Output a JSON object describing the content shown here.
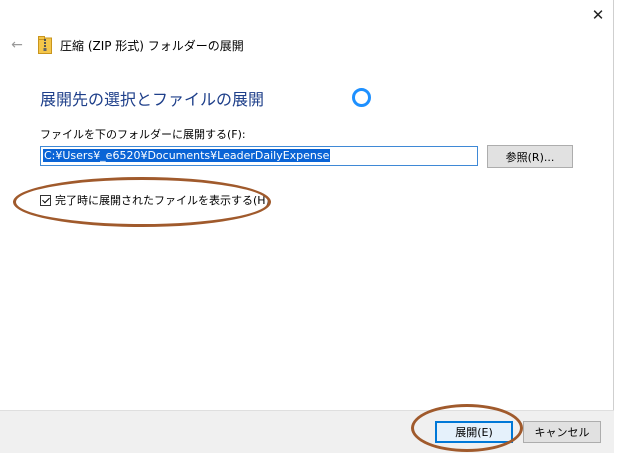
{
  "window": {
    "title": "圧縮 (ZIP 形式) フォルダーの展開",
    "close_symbol": "✕",
    "back_symbol": "←"
  },
  "main": {
    "heading": "展開先の選択とファイルの展開",
    "dest_label": "ファイルを下のフォルダーに展開する(F):",
    "dest_path": "C:¥Users¥_e6520¥Documents¥LeaderDailyExpense",
    "browse_label": "参照(R)...",
    "show_files_label": "完了時に展開されたファイルを表示する(H)",
    "show_files_checked": true
  },
  "footer": {
    "extract_label": "展開(E)",
    "cancel_label": "キャンセル"
  },
  "icons": {
    "back": "back-arrow-icon",
    "zip": "zip-folder-icon",
    "close": "close-icon",
    "spinner": "loading-spinner-icon"
  },
  "colors": {
    "heading": "#1e3f8a",
    "accent": "#0078d7",
    "selection": "#0a64d6",
    "annotation": "#a05a2c"
  }
}
